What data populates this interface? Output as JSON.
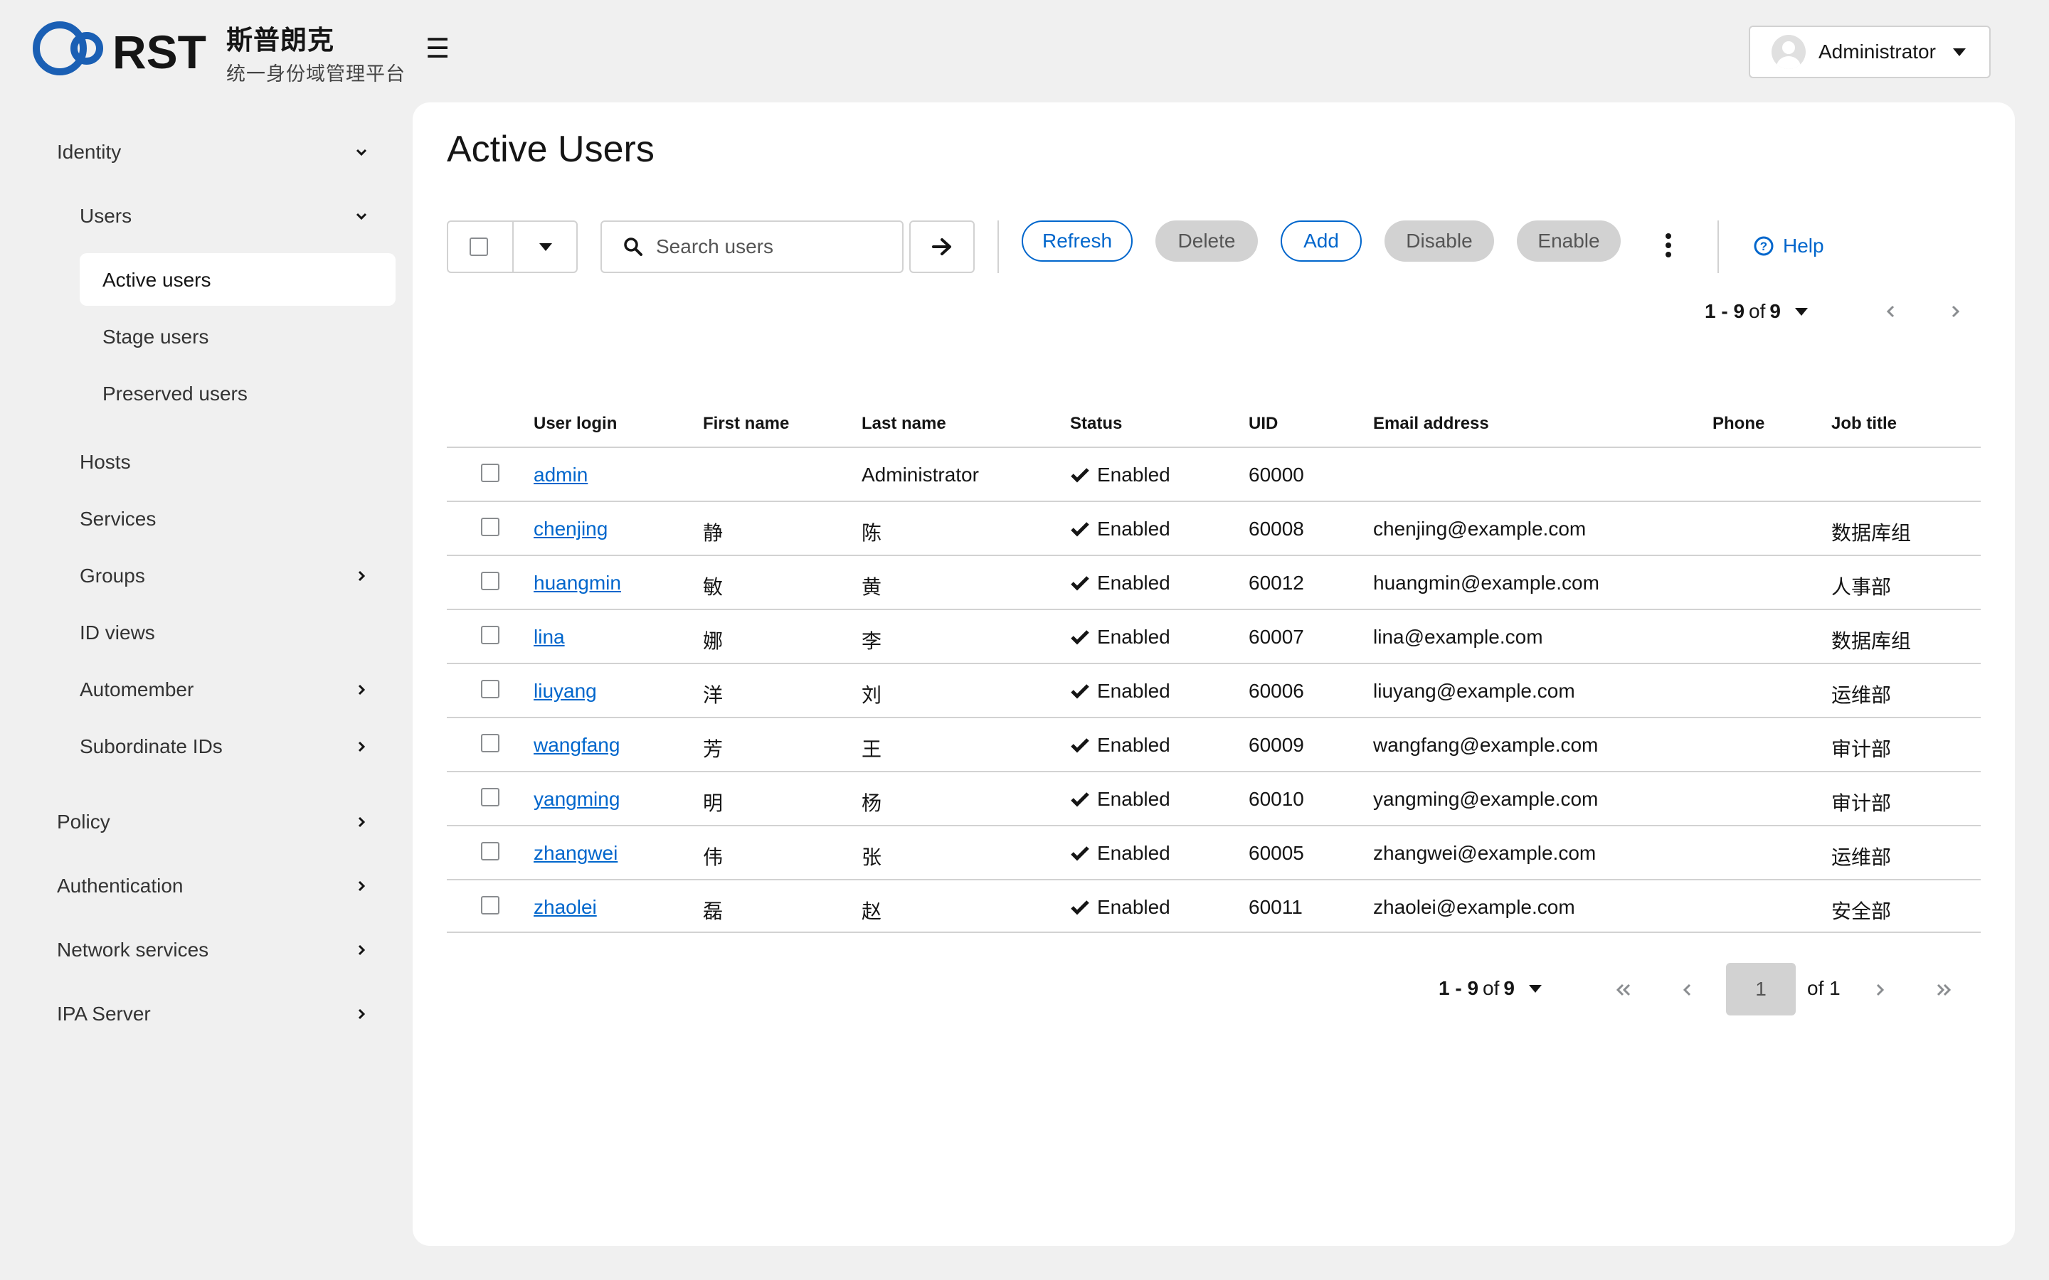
{
  "header": {
    "brand_cn": "斯普朗克",
    "brand_sub": "统一身份域管理平台",
    "user_name": "Administrator"
  },
  "sidebar": {
    "identity": "Identity",
    "users": "Users",
    "active_users": "Active users",
    "stage_users": "Stage users",
    "preserved_users": "Preserved users",
    "hosts": "Hosts",
    "services": "Services",
    "groups": "Groups",
    "id_views": "ID views",
    "automember": "Automember",
    "subordinate_ids": "Subordinate IDs",
    "policy": "Policy",
    "authentication": "Authentication",
    "network_services": "Network services",
    "ipa_server": "IPA Server"
  },
  "main": {
    "title": "Active Users",
    "search_placeholder": "Search users",
    "buttons": {
      "refresh": "Refresh",
      "delete": "Delete",
      "add": "Add",
      "disable": "Disable",
      "enable": "Enable",
      "help": "Help"
    },
    "pagination": {
      "range": "1 - 9",
      "of_word": "of",
      "total": "9",
      "page": "1",
      "page_of": "of 1"
    }
  },
  "table": {
    "columns": [
      "User login",
      "First name",
      "Last name",
      "Status",
      "UID",
      "Email address",
      "Phone",
      "Job title"
    ],
    "rows": [
      {
        "login": "admin",
        "first": "",
        "last": "Administrator",
        "status": "Enabled",
        "uid": "60000",
        "email": "",
        "phone": "",
        "job": ""
      },
      {
        "login": "chenjing",
        "first": "静",
        "last": "陈",
        "status": "Enabled",
        "uid": "60008",
        "email": "chenjing@example.com",
        "phone": "",
        "job": "数据库组"
      },
      {
        "login": "huangmin",
        "first": "敏",
        "last": "黄",
        "status": "Enabled",
        "uid": "60012",
        "email": "huangmin@example.com",
        "phone": "",
        "job": "人事部"
      },
      {
        "login": "lina",
        "first": "娜",
        "last": "李",
        "status": "Enabled",
        "uid": "60007",
        "email": "lina@example.com",
        "phone": "",
        "job": "数据库组"
      },
      {
        "login": "liuyang",
        "first": "洋",
        "last": "刘",
        "status": "Enabled",
        "uid": "60006",
        "email": "liuyang@example.com",
        "phone": "",
        "job": "运维部"
      },
      {
        "login": "wangfang",
        "first": "芳",
        "last": "王",
        "status": "Enabled",
        "uid": "60009",
        "email": "wangfang@example.com",
        "phone": "",
        "job": "审计部"
      },
      {
        "login": "yangming",
        "first": "明",
        "last": "杨",
        "status": "Enabled",
        "uid": "60010",
        "email": "yangming@example.com",
        "phone": "",
        "job": "审计部"
      },
      {
        "login": "zhangwei",
        "first": "伟",
        "last": "张",
        "status": "Enabled",
        "uid": "60005",
        "email": "zhangwei@example.com",
        "phone": "",
        "job": "运维部"
      },
      {
        "login": "zhaolei",
        "first": "磊",
        "last": "赵",
        "status": "Enabled",
        "uid": "60011",
        "email": "zhaolei@example.com",
        "phone": "",
        "job": "安全部"
      }
    ]
  },
  "icons": {
    "logo": "rst-logo",
    "menu": "hamburger-icon",
    "search": "search-icon",
    "go": "arrow-right-icon",
    "status": "check-icon",
    "help": "question-circle-icon"
  },
  "colors": {
    "link": "#0066cc",
    "background": "#f0f0f0",
    "card": "#ffffff",
    "disabled_button": "#d2d2d2",
    "logo_blue": "#1a5fb4"
  }
}
